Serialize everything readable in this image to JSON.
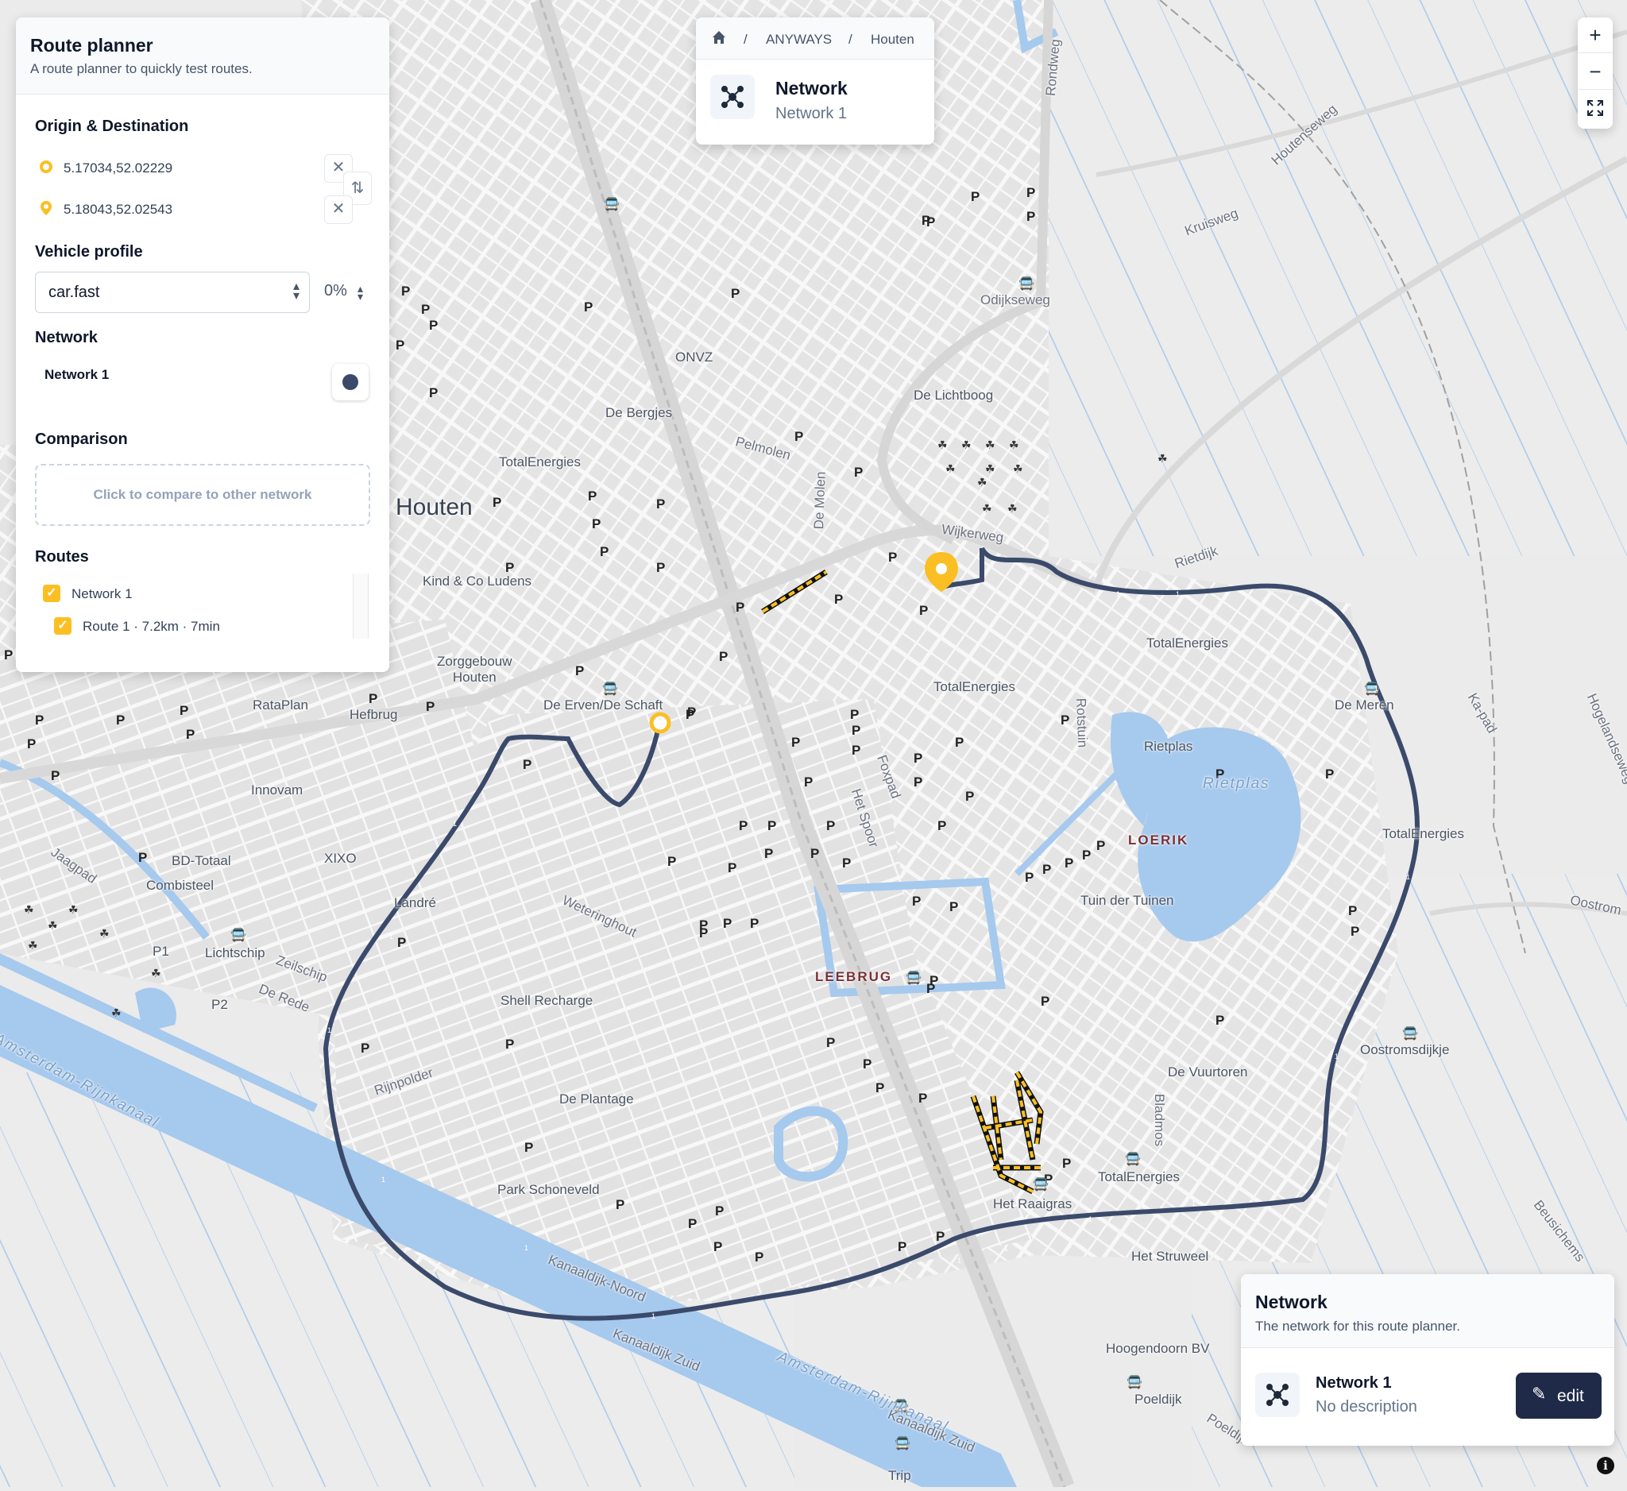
{
  "planner": {
    "title": "Route planner",
    "subtitle": "A route planner to quickly test routes.",
    "origin_destination_title": "Origin & Destination",
    "origin": "5.17034,52.02229",
    "destination": "5.18043,52.02543",
    "clear_icon": "close-icon",
    "swap_icon": "swap-icon",
    "vehicle_profile_title": "Vehicle profile",
    "vehicle_profile": "car.fast",
    "percentage": "0%",
    "network_title": "Network",
    "network_name": "Network 1",
    "network_color": "#3b4a6b",
    "comparison_title": "Comparison",
    "compare_prompt": "Click to compare to other network",
    "routes_title": "Routes",
    "routes": [
      {
        "label": "Network 1",
        "checked": true
      },
      {
        "label": "Route 1 · 7.2km · 7min",
        "checked": true
      }
    ]
  },
  "breadcrumb": {
    "home_icon": "home-icon",
    "items": [
      "ANYWAYS",
      "Houten"
    ],
    "separator": "/",
    "network_title": "Network",
    "network_name": "Network 1"
  },
  "zoom": {
    "in": "+",
    "out": "−",
    "fullscreen_icon": "fullscreen-icon"
  },
  "network_panel": {
    "title": "Network",
    "subtitle": "The network for this route planner.",
    "name": "Network 1",
    "description": "No description",
    "edit_label": "edit",
    "edit_icon": "edit-icon"
  },
  "map": {
    "accent": "#fbbf24",
    "route_color": "#3b4a6b",
    "labels": {
      "houten": "Houten",
      "loerik": "LOERIK",
      "leebrug": "LEEBRUG",
      "onvz": "ONVZ",
      "de_bergjes": "De Bergjes",
      "totalenergies_1": "TotalEnergies",
      "pelmolen": "Pelmolen",
      "de_molen": "De Molen",
      "de_lichtboog": "De Lichtboog",
      "odijkseweg": "Odijkseweg",
      "kruisweg": "Kruisweg",
      "houtenseweg": "Houtenseweg",
      "rondweg": "Rondweg",
      "wijkerweg": "Wijkerweg",
      "rietdijk": "Rietdijk",
      "totalenergies_2": "TotalEnergies",
      "totalenergies_3": "TotalEnergies",
      "kind_co_ludens": "Kind & Co Ludens",
      "zorggebouw_houten": "Zorggebouw\nHouten",
      "de_erven": "De Erven/De Schaft",
      "rataplan": "RataPlan",
      "hefbrug": "Hefbrug",
      "innovam": "Innovam",
      "bd_totaal": "BD-Totaal",
      "xixo": "XIXO",
      "combisteel": "Combisteel",
      "jaagpad": "Jaagpad",
      "lichtschip": "Lichtschip",
      "zeilschip": "Zeilschip",
      "de_rede": "De Rede",
      "p1": "P1",
      "p2": "P2",
      "landre": "Landré",
      "rotstuin": "Rotstuin",
      "rietplas": "Rietplas",
      "rietplas_water": "Rietplas",
      "de_meren": "De Meren",
      "totalenergies_4": "TotalEnergies",
      "tuin_der_tuinen": "Tuin der Tuinen",
      "het_spoor": "Het Spoor",
      "foxpad": "Foxpad",
      "weteringhout": "Weteringhout",
      "shell_recharge": "Shell Recharge",
      "rijnpolder": "Rijnpolder",
      "de_plantage": "De Plantage",
      "park_schoneveld": "Park Schoneveld",
      "amsterdam_rijnkanaal_1": "Amsterdam-Rijnkanaal",
      "amsterdam_rijnkanaal_2": "Amsterdam-Rijnkanaal",
      "kanaaldijk_noord": "Kanaaldijk-Noord",
      "kanaaldijk_zuid_1": "Kanaaldijk Zuid",
      "kanaaldijk_zuid_2": "Kanaaldijk Zuid",
      "het_raaigras": "Het Raaigras",
      "bladmos": "Bladmos",
      "totalenergies_5": "TotalEnergies",
      "de_vuurtoren": "De Vuurtoren",
      "oostromsdijkje": "Oostromsdijkje",
      "oostrom": "Oostrom",
      "het_struweel": "Het Struweel",
      "hoogendoorn": "Hoogendoorn BV",
      "poeldijk_1": "Poeldijk",
      "poeldijk_2": "Poeldijk",
      "trip": "Trip",
      "ka_pad": "Ka-pad",
      "hogelandseweg": "Hogelandseweg",
      "beusichemse": "Beusichems"
    }
  }
}
